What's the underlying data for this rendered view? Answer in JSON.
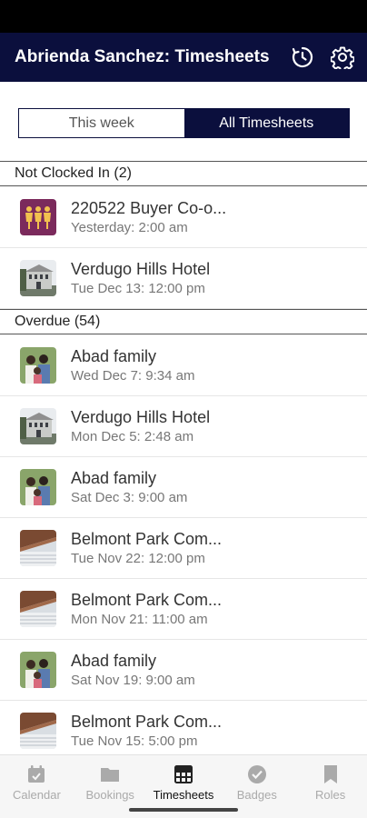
{
  "app_bar": {
    "title": "Abrienda Sanchez: Timesheets",
    "icons": [
      "history-icon",
      "gear-icon"
    ]
  },
  "segment": {
    "options": [
      "This week",
      "All Timesheets"
    ],
    "selected": "All Timesheets"
  },
  "sections": [
    {
      "header": "Not Clocked In (2)",
      "items": [
        {
          "title": "220522 Buyer Co-o...",
          "subtitle": "Yesterday: 2:00 am",
          "thumb": "people-icon"
        },
        {
          "title": "Verdugo Hills Hotel",
          "subtitle": "Tue Dec 13: 12:00 pm",
          "thumb": "hotel-photo"
        }
      ]
    },
    {
      "header": "Overdue (54)",
      "items": [
        {
          "title": "Abad family",
          "subtitle": "Wed Dec 7: 9:34 am",
          "thumb": "family-photo"
        },
        {
          "title": "Verdugo Hills Hotel",
          "subtitle": "Mon Dec 5: 2:48 am",
          "thumb": "hotel-photo"
        },
        {
          "title": "Abad family",
          "subtitle": "Sat Dec 3: 9:00 am",
          "thumb": "family-photo"
        },
        {
          "title": "Belmont Park Com...",
          "subtitle": "Tue Nov 22: 12:00 pm",
          "thumb": "building-photo"
        },
        {
          "title": "Belmont Park Com...",
          "subtitle": "Mon Nov 21: 11:00 am",
          "thumb": "building-photo"
        },
        {
          "title": "Abad family",
          "subtitle": "Sat Nov 19: 9:00 am",
          "thumb": "family-photo"
        },
        {
          "title": "Belmont Park Com...",
          "subtitle": "Tue Nov 15: 5:00 pm",
          "thumb": "building-photo"
        }
      ]
    }
  ],
  "bottom_nav": {
    "items": [
      {
        "label": "Calendar",
        "icon": "calendar-icon"
      },
      {
        "label": "Bookings",
        "icon": "folder-icon"
      },
      {
        "label": "Timesheets",
        "icon": "timesheet-icon"
      },
      {
        "label": "Badges",
        "icon": "badge-check-icon"
      },
      {
        "label": "Roles",
        "icon": "bookmark-icon"
      }
    ],
    "active": "Timesheets"
  },
  "colors": {
    "brand": "#0b0f3d",
    "people_thumb": "#7b2a5c",
    "people_figures": "#f2c14e"
  }
}
